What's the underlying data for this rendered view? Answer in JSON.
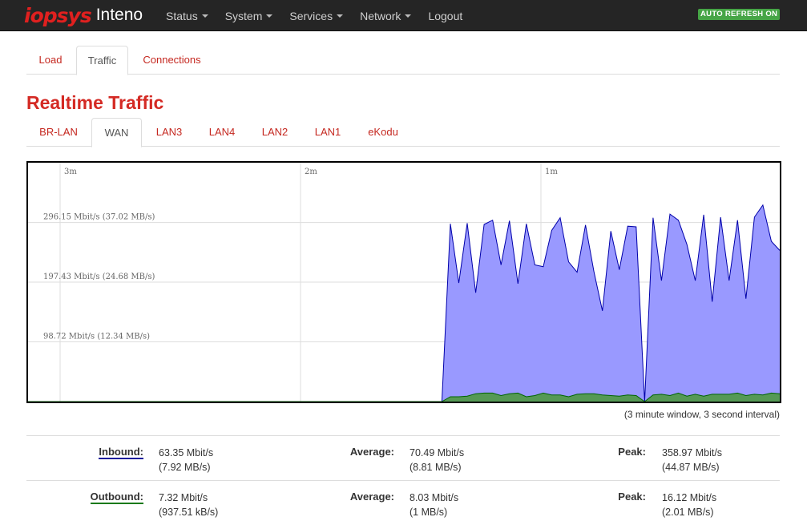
{
  "navbar": {
    "logo": "iopsys",
    "product": "Inteno",
    "menu": [
      "Status",
      "System",
      "Services",
      "Network"
    ],
    "logout": "Logout",
    "auto_refresh": "AUTO REFRESH ON"
  },
  "main_tabs": [
    "Load",
    "Traffic",
    "Connections"
  ],
  "main_active_tab": "Traffic",
  "title": "Realtime Traffic",
  "interface_tabs": [
    "BR-LAN",
    "WAN",
    "LAN3",
    "LAN4",
    "LAN2",
    "LAN1",
    "eKodu"
  ],
  "interface_active_tab": "WAN",
  "graph": {
    "time_labels": [
      "3m",
      "2m",
      "1m"
    ],
    "scale_labels": [
      "296.15 Mbit/s (37.02 MB/s)",
      "197.43 Mbit/s (24.68 MB/s)",
      "98.72 Mbit/s (12.34 MB/s)"
    ],
    "window_note": "(3 minute window, 3 second interval)",
    "colors": {
      "inbound_fill": "#9999ff",
      "inbound_line": "#0000aa",
      "outbound_fill": "#559955",
      "outbound_line": "#006600",
      "grid": "#dddddd"
    }
  },
  "chart_data": {
    "type": "area",
    "x_window_seconds": 180,
    "ylim": [
      0,
      395
    ],
    "y_ticks": [
      98.72,
      197.43,
      296.15
    ],
    "series": [
      {
        "name": "Inbound",
        "samples_every_seconds": 3,
        "values": [
          0,
          0,
          0,
          0,
          0,
          0,
          0,
          0,
          0,
          0,
          0,
          0,
          0,
          0,
          0,
          0,
          0,
          0,
          0,
          0,
          0,
          0,
          0,
          0,
          0,
          0,
          0,
          0,
          0,
          0,
          0,
          0,
          0,
          0,
          0,
          0,
          0,
          0,
          0,
          0,
          0,
          0,
          0,
          0,
          0,
          0,
          0,
          0,
          0,
          0,
          0,
          0,
          0,
          0,
          0,
          0,
          0,
          0,
          0,
          0,
          0,
          0,
          0,
          0,
          0,
          0,
          0,
          0,
          0,
          0,
          0,
          0,
          0,
          0,
          0,
          0,
          0,
          0,
          0,
          0,
          0,
          0,
          0,
          0,
          0,
          0,
          0,
          0,
          0,
          0,
          0,
          0,
          0,
          0,
          0,
          0,
          0,
          0,
          0,
          0
        ]
      },
      {
        "name": "Outbound",
        "values": []
      }
    ]
  },
  "stats": {
    "inbound": {
      "label": "Inbound:",
      "current": "63.35 Mbit/s",
      "current_bytes": "(7.92 MB/s)",
      "avg_label": "Average:",
      "avg": "70.49 Mbit/s",
      "avg_bytes": "(8.81 MB/s)",
      "peak_label": "Peak:",
      "peak": "358.97 Mbit/s",
      "peak_bytes": "(44.87 MB/s)"
    },
    "outbound": {
      "label": "Outbound:",
      "current": "7.32 Mbit/s",
      "current_bytes": "(937.51 kB/s)",
      "avg_label": "Average:",
      "avg": "8.03 Mbit/s",
      "avg_bytes": "(1 MB/s)",
      "peak_label": "Peak:",
      "peak": "16.12 Mbit/s",
      "peak_bytes": "(2.01 MB/s)"
    }
  }
}
